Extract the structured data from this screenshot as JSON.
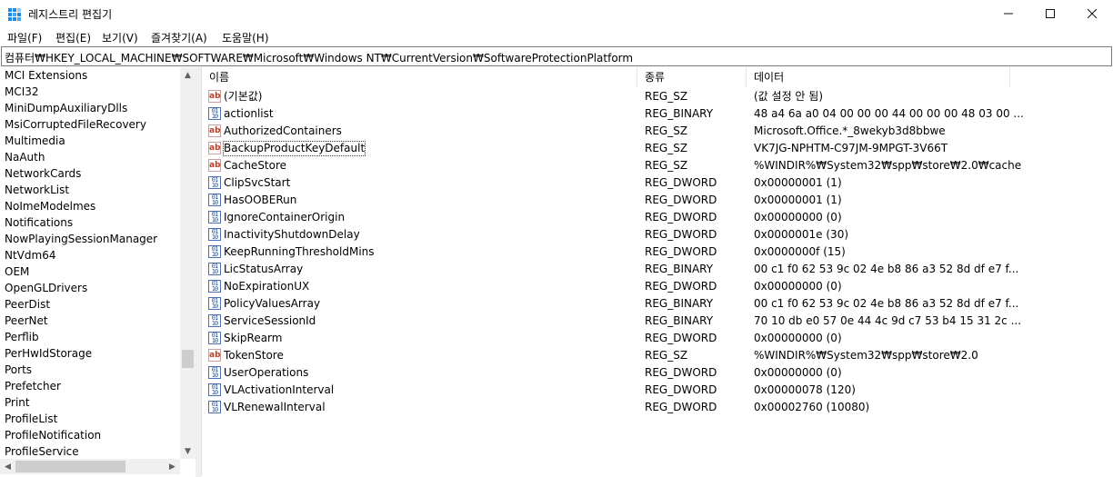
{
  "window": {
    "title": "레지스트리 편집기"
  },
  "menu": [
    "파일(F)",
    "편집(E)",
    "보기(V)",
    "즐겨찾기(A)",
    "도움말(H)"
  ],
  "address": "컴퓨터₩HKEY_LOCAL_MACHINE₩SOFTWARE₩Microsoft₩Windows NT₩CurrentVersion₩SoftwareProtectionPlatform",
  "tree": [
    "MCI Extensions",
    "MCI32",
    "MiniDumpAuxiliaryDlls",
    "MsiCorruptedFileRecovery",
    "Multimedia",
    "NaAuth",
    "NetworkCards",
    "NetworkList",
    "NoImeModelmes",
    "Notifications",
    "NowPlayingSessionManager",
    "NtVdm64",
    "OEM",
    "OpenGLDrivers",
    "PeerDist",
    "PeerNet",
    "Perflib",
    "PerHwIdStorage",
    "Ports",
    "Prefetcher",
    "Print",
    "ProfileList",
    "ProfileNotification",
    "ProfileService"
  ],
  "columns": {
    "name": "이름",
    "type": "종류",
    "data": "데이터"
  },
  "rows": [
    {
      "icon": "string-value-icon",
      "name": "(기본값)",
      "type": "REG_SZ",
      "data": "(값 설정 안 됨)"
    },
    {
      "icon": "binary-value-icon",
      "name": "actionlist",
      "type": "REG_BINARY",
      "data": "48 a4 6a a0 04 00 00 00 44 00 00 00 48 03 00 ..."
    },
    {
      "icon": "string-value-icon",
      "name": "AuthorizedContainers",
      "type": "REG_SZ",
      "data": "Microsoft.Office.*_8wekyb3d8bbwe"
    },
    {
      "icon": "string-value-icon",
      "name": "BackupProductKeyDefault",
      "type": "REG_SZ",
      "data": "VK7JG-NPHTM-C97JM-9MPGT-3V66T",
      "focused": true
    },
    {
      "icon": "string-value-icon",
      "name": "CacheStore",
      "type": "REG_SZ",
      "data": "%WINDIR%₩System32₩spp₩store₩2.0₩cache"
    },
    {
      "icon": "binary-value-icon",
      "name": "ClipSvcStart",
      "type": "REG_DWORD",
      "data": "0x00000001 (1)"
    },
    {
      "icon": "binary-value-icon",
      "name": "HasOOBERun",
      "type": "REG_DWORD",
      "data": "0x00000001 (1)"
    },
    {
      "icon": "binary-value-icon",
      "name": "IgnoreContainerOrigin",
      "type": "REG_DWORD",
      "data": "0x00000000 (0)"
    },
    {
      "icon": "binary-value-icon",
      "name": "InactivityShutdownDelay",
      "type": "REG_DWORD",
      "data": "0x0000001e (30)"
    },
    {
      "icon": "binary-value-icon",
      "name": "KeepRunningThresholdMins",
      "type": "REG_DWORD",
      "data": "0x0000000f (15)"
    },
    {
      "icon": "binary-value-icon",
      "name": "LicStatusArray",
      "type": "REG_BINARY",
      "data": "00 c1 f0 62 53 9c 02 4e b8 86 a3 52 8d df e7 f..."
    },
    {
      "icon": "binary-value-icon",
      "name": "NoExpirationUX",
      "type": "REG_DWORD",
      "data": "0x00000000 (0)"
    },
    {
      "icon": "binary-value-icon",
      "name": "PolicyValuesArray",
      "type": "REG_BINARY",
      "data": "00 c1 f0 62 53 9c 02 4e b8 86 a3 52 8d df e7 f..."
    },
    {
      "icon": "binary-value-icon",
      "name": "ServiceSessionId",
      "type": "REG_BINARY",
      "data": "70 10 db e0 57 0e 44 4c 9d c7 53 b4 15 31 2c ..."
    },
    {
      "icon": "binary-value-icon",
      "name": "SkipRearm",
      "type": "REG_DWORD",
      "data": "0x00000000 (0)"
    },
    {
      "icon": "string-value-icon",
      "name": "TokenStore",
      "type": "REG_SZ",
      "data": "%WINDIR%₩System32₩spp₩store₩2.0"
    },
    {
      "icon": "binary-value-icon",
      "name": "UserOperations",
      "type": "REG_DWORD",
      "data": "0x00000000 (0)"
    },
    {
      "icon": "binary-value-icon",
      "name": "VLActivationInterval",
      "type": "REG_DWORD",
      "data": "0x00000078 (120)"
    },
    {
      "icon": "binary-value-icon",
      "name": "VLRenewalInterval",
      "type": "REG_DWORD",
      "data": "0x00002760 (10080)"
    }
  ]
}
